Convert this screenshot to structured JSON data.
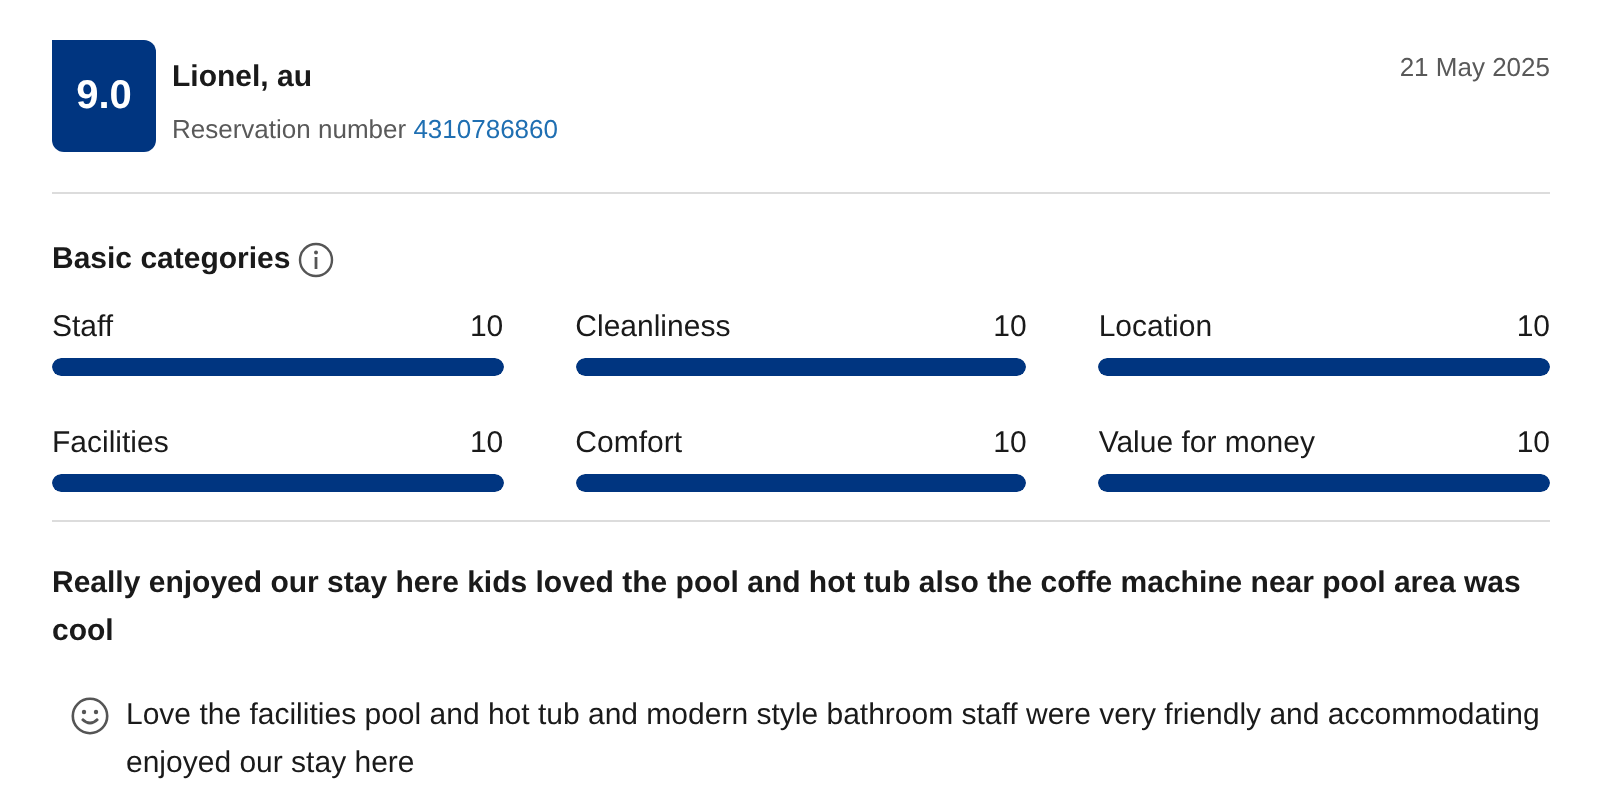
{
  "review": {
    "score": "9.0",
    "reviewer": "Lionel, au",
    "reservation_label": "Reservation number",
    "reservation_number": "4310786860",
    "date": "21 May 2025"
  },
  "categories": {
    "title": "Basic categories",
    "items": [
      {
        "name": "Staff",
        "score": "10",
        "level": 1
      },
      {
        "name": "Cleanliness",
        "score": "10",
        "level": 1
      },
      {
        "name": "Location",
        "score": "10",
        "level": 1
      },
      {
        "name": "Facilities",
        "score": "10",
        "level": 1
      },
      {
        "name": "Comfort",
        "score": "10",
        "level": 1
      },
      {
        "name": "Value for money",
        "score": "10",
        "level": 1
      }
    ]
  },
  "headline": "Really enjoyed our stay here kids loved the pool and hot tub also the coffe machine near pool area was cool",
  "comments": [
    {
      "kind": "positive",
      "text": "Love the facilities pool and hot tub and modern style bathroom staff were very friendly and accommodating enjoyed our stay here"
    }
  ]
}
